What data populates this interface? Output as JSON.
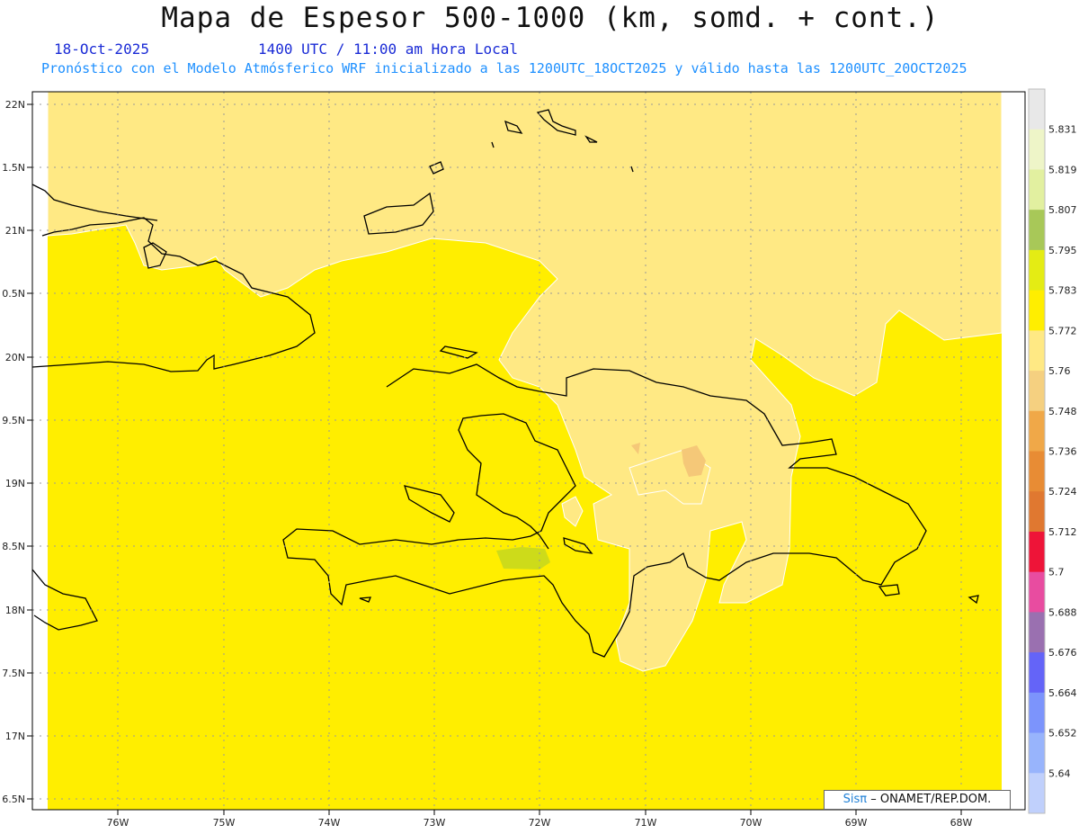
{
  "header": {
    "title": "Mapa de Espesor 500-1000 (km, somd. + cont.)",
    "date": "18-Oct-2025",
    "time": "1400 UTC / 11:00 am Hora Local",
    "description": "Pronóstico con el Modelo Atmósferico WRF inicializado a las 1200UTC_18OCT2025 y válido hasta las  1200UTC_20OCT2025"
  },
  "map": {
    "lat_labels": [
      "22N",
      "1.5N",
      "21N",
      "0.5N",
      "20N",
      "9.5N",
      "19N",
      "8.5N",
      "18N",
      "7.5N",
      "17N",
      "6.5N"
    ],
    "lon_labels": [
      "76W",
      "75W",
      "74W",
      "73W",
      "72W",
      "71W",
      "70W",
      "69W",
      "68W"
    ],
    "colors": {
      "base": "#ffee00",
      "light": "#ffe984",
      "orange": "#f5c878",
      "green": "#cddb1a",
      "coast": "#000000",
      "grid": "#888888"
    }
  },
  "colorbar": {
    "labels": [
      "5.831",
      "5.819",
      "5.807",
      "5.795",
      "5.783",
      "5.772",
      "5.76",
      "5.748",
      "5.736",
      "5.724",
      "5.712",
      "5.7",
      "5.688",
      "5.676",
      "5.664",
      "5.652",
      "5.64"
    ],
    "colors": [
      "#e8e8e8",
      "#eef5c8",
      "#e2f0a0",
      "#a8c858",
      "#e4ec14",
      "#ffee00",
      "#ffe984",
      "#f5d080",
      "#f0a848",
      "#e88c34",
      "#e07830",
      "#ee1438",
      "#e84ca0",
      "#9a70b0",
      "#6464f8",
      "#7c94fc",
      "#98b4fc",
      "#c0d0fc"
    ]
  },
  "credit": {
    "brand": "Sisπ",
    "text": "– ONAMET/REP.DOM."
  }
}
